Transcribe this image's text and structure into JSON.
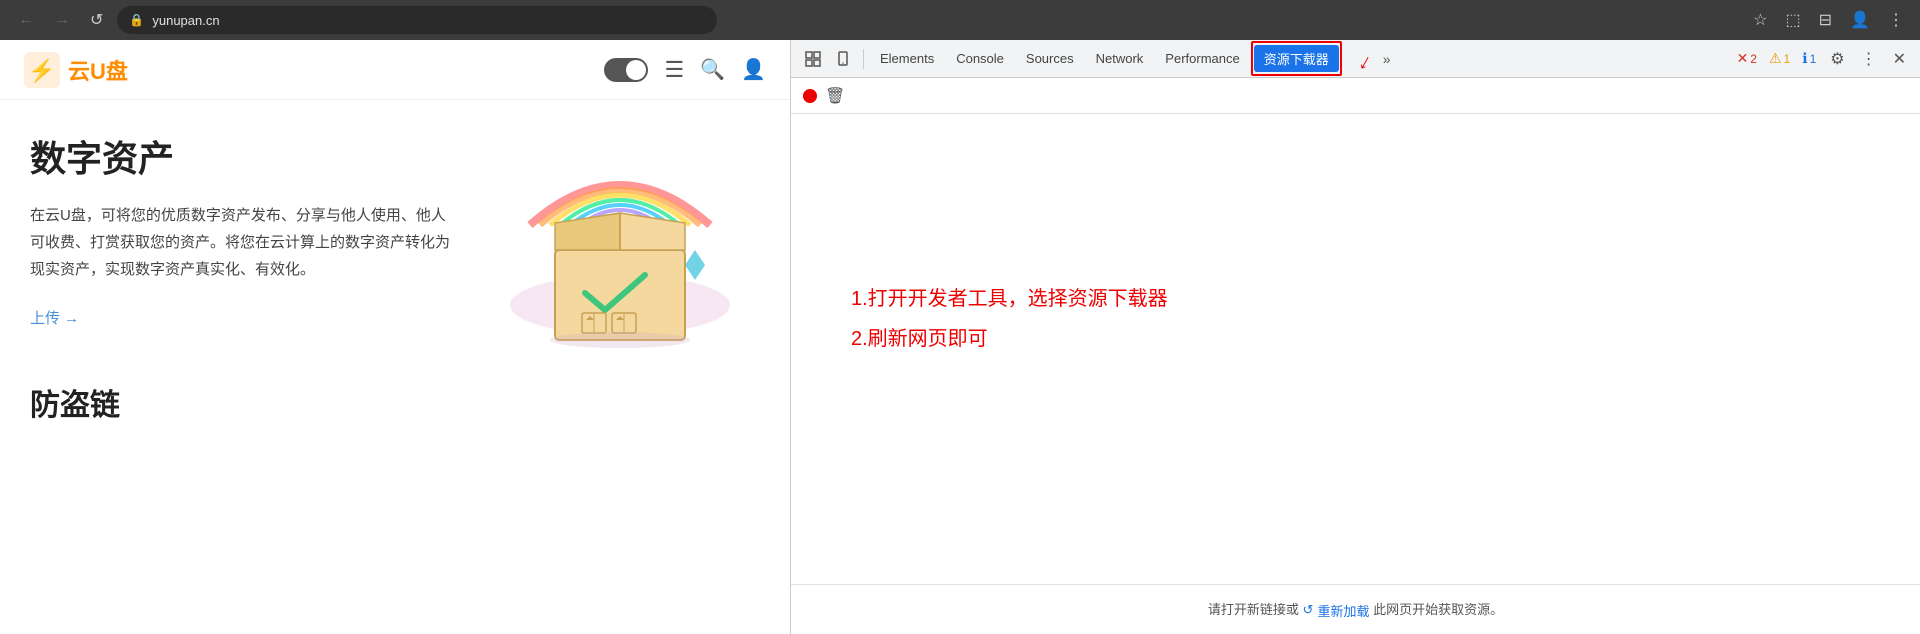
{
  "browser": {
    "url": "yunupan.cn",
    "back_btn": "←",
    "forward_btn": "→",
    "refresh_btn": "↺",
    "bookmark_icon": "☆",
    "extensions_icon": "⬚",
    "split_icon": "⊟",
    "profile_icon": "👤",
    "menu_icon": "⋮"
  },
  "website": {
    "logo_text": "云U盘",
    "toggle_label": "dark mode toggle",
    "menu_icon": "☰",
    "search_icon": "🔍",
    "user_icon": "👤",
    "hero_title": "数字资产",
    "hero_desc": "在云U盘，可将您的优质数字资产发布、分享与他人使用、他人可收费、打赏获取您的资产。将您在云计算上的数字资产转化为现实资产，实现数字资产真实化、有效化。",
    "upload_link": "上传 →",
    "section2_title": "防盗链"
  },
  "devtools": {
    "inspect_icon": "⬚",
    "device_icon": "📱",
    "tabs": [
      {
        "id": "elements",
        "label": "Elements",
        "active": false
      },
      {
        "id": "console",
        "label": "Console",
        "active": false
      },
      {
        "id": "sources",
        "label": "Sources",
        "active": false
      },
      {
        "id": "network",
        "label": "Network",
        "active": false
      },
      {
        "id": "performance",
        "label": "Performance",
        "active": false
      },
      {
        "id": "resource-downloader",
        "label": "资源下载器",
        "active": true
      }
    ],
    "more_label": "»",
    "error_count": "2",
    "warning_count": "1",
    "info_count": "1",
    "settings_icon": "⚙",
    "kebab_icon": "⋮",
    "close_icon": "✕",
    "sub_toolbar": {
      "record_label": "record",
      "trash_label": "clear"
    },
    "instruction_line1": "1.打开开发者工具，选择资源下载器",
    "instruction_line2": "2.刷新网页即可",
    "empty_state_text": "请打开新链接或",
    "reload_text": "重新加载",
    "empty_suffix": "此网页开始获取资源。",
    "reload_icon": "↺"
  }
}
